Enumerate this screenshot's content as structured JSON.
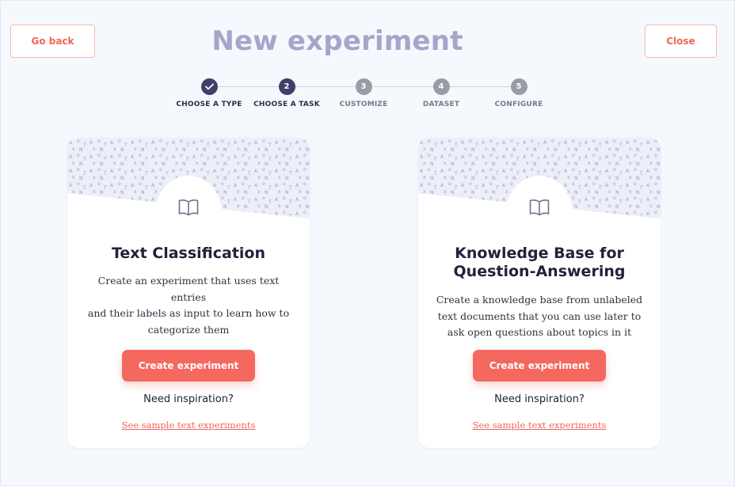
{
  "header": {
    "title": "New experiment",
    "go_back_label": "Go back",
    "close_label": "Close"
  },
  "stepper": {
    "steps": [
      {
        "number": "",
        "label": "CHOOSE A TYPE",
        "state": "done"
      },
      {
        "number": "2",
        "label": "CHOOSE A TASK",
        "state": "active"
      },
      {
        "number": "3",
        "label": "CUSTOMIZE",
        "state": "pending"
      },
      {
        "number": "4",
        "label": "DATASET",
        "state": "pending"
      },
      {
        "number": "5",
        "label": "CONFIGURE",
        "state": "pending"
      }
    ]
  },
  "cards": [
    {
      "title_line1": "Text Classification",
      "title_line2": "",
      "description_lines": [
        "Create an experiment that uses text entries",
        "and their labels as input to learn how to",
        "categorize them"
      ],
      "create_label": "Create experiment",
      "inspiration": "Need inspiration?",
      "sample_link": "See sample text experiments",
      "icon": "book-icon"
    },
    {
      "title_line1": "Knowledge Base for",
      "title_line2": "Question-Answering",
      "description_lines": [
        "Create a knowledge base from unlabeled",
        "text documents that you can use later to",
        "ask open questions about topics in it"
      ],
      "create_label": "Create experiment",
      "inspiration": "Need inspiration?",
      "sample_link": "See sample text experiments",
      "icon": "book-icon"
    }
  ],
  "colors": {
    "accent": "#f4685f",
    "step_active": "#3d4169",
    "step_pending": "#9a9ca4",
    "title": "#a4a7c9",
    "background": "#f5f8fd"
  }
}
